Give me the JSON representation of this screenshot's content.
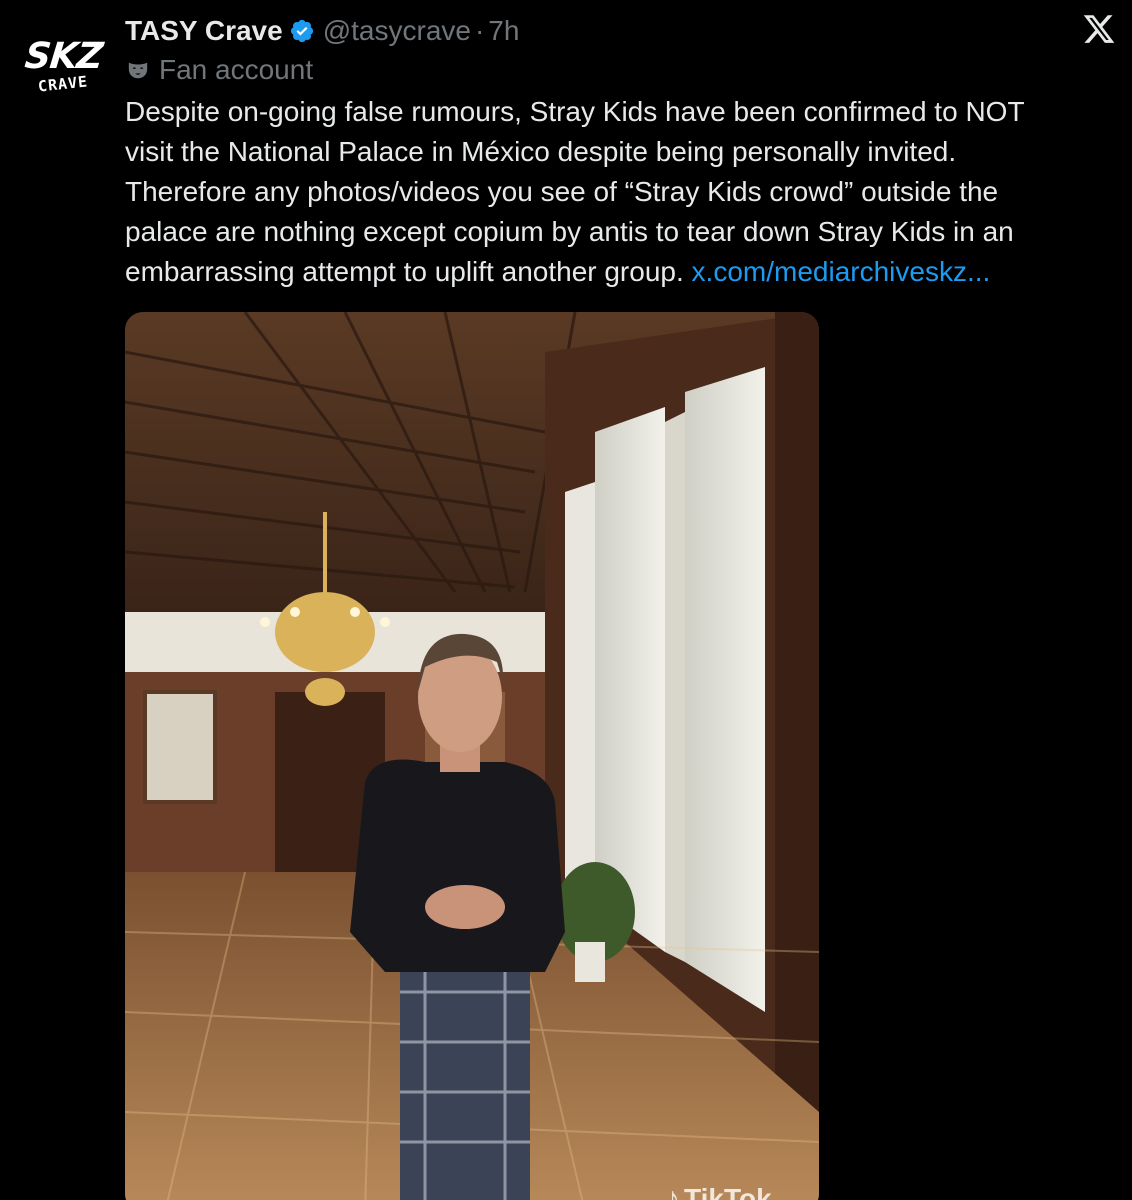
{
  "account": {
    "avatar_text_top": "SKZ",
    "avatar_text_bottom": "CRAVE",
    "display_name": "TASY Crave",
    "handle": "@tasycrave",
    "separator": "·",
    "time": "7h",
    "label": "Fan account",
    "verified_color": "#1d9bf0"
  },
  "tweet": {
    "lines": [
      "Despite on-going false rumours, Stray Kids have been confirmed to NOT",
      "visit the National Palace in México despite being personally invited.",
      "Therefore any photos/videos you see of “Stray Kids crowd” outside the",
      "palace are nothing except copium by antis to tear down Stray Kids in an"
    ],
    "last_line": "embarrassing attempt to uplift another group.",
    "link": "x.com/mediarchiveskz..."
  },
  "media": {
    "watermark": "TikTok"
  },
  "icons": {
    "close": "x-logo-icon",
    "verified": "verified-badge-icon",
    "label": "mask-icon"
  }
}
